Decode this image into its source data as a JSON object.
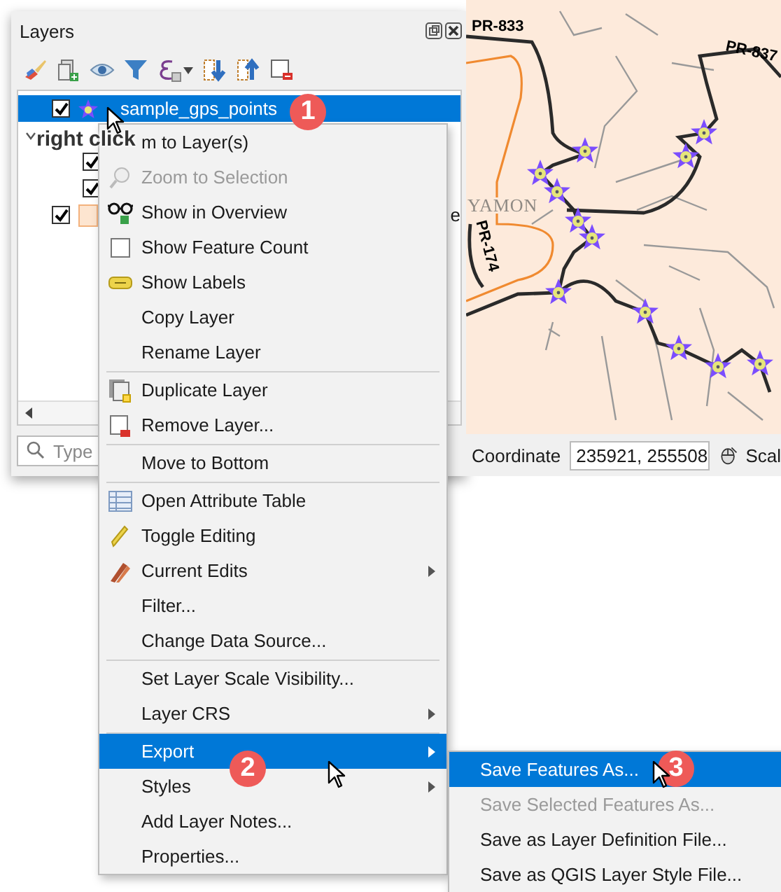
{
  "layers_panel": {
    "title": "Layers",
    "layers": [
      {
        "kind": "layer",
        "name": "sample_gps_points",
        "checked": true,
        "selected": true
      },
      {
        "kind": "group",
        "expanded": true,
        "selected": false,
        "children": [
          {
            "kind": "layer",
            "checked": true,
            "selected": false
          },
          {
            "kind": "layer",
            "checked": true,
            "selected": false
          }
        ]
      },
      {
        "kind": "layer",
        "name": "e",
        "checked": true,
        "selected": false
      }
    ],
    "search": {
      "placeholder": "Type"
    }
  },
  "map": {
    "labels": [
      {
        "kind": "road",
        "text": "PR-833"
      },
      {
        "kind": "road",
        "text": "PR-837"
      },
      {
        "kind": "road-vertical",
        "text": "PR-174"
      },
      {
        "kind": "place",
        "text": "YAMON"
      }
    ]
  },
  "status_bar": {
    "coordinate_label": "Coordinate",
    "coordinate_value": "235921, 255508",
    "scale_label": "Scal"
  },
  "annotation": "right click",
  "steps": [
    {
      "number": "1"
    },
    {
      "number": "2"
    },
    {
      "number": "3"
    }
  ],
  "context_menu": {
    "items": [
      {
        "kind": "action",
        "label": "m to Layer(s)",
        "disabled": false,
        "selected": false
      },
      {
        "kind": "action",
        "label": "Zoom to Selection",
        "disabled": true,
        "selected": false
      },
      {
        "kind": "action",
        "label": "Show in Overview",
        "disabled": false,
        "selected": false
      },
      {
        "kind": "checkbox",
        "label": "Show Feature Count",
        "checked": false,
        "disabled": false,
        "selected": false
      },
      {
        "kind": "action",
        "label": "Show Labels",
        "disabled": false,
        "selected": false
      },
      {
        "kind": "action",
        "label": "Copy Layer",
        "disabled": false,
        "selected": false
      },
      {
        "kind": "action",
        "label": "Rename Layer",
        "disabled": false,
        "selected": false
      },
      {
        "kind": "separator"
      },
      {
        "kind": "action",
        "label": "Duplicate Layer",
        "disabled": false,
        "selected": false
      },
      {
        "kind": "action",
        "label": "Remove Layer...",
        "disabled": false,
        "selected": false
      },
      {
        "kind": "separator"
      },
      {
        "kind": "action",
        "label": "Move to Bottom",
        "disabled": false,
        "selected": false
      },
      {
        "kind": "separator"
      },
      {
        "kind": "action",
        "label": "Open Attribute Table",
        "disabled": false,
        "selected": false
      },
      {
        "kind": "action",
        "label": "Toggle Editing",
        "disabled": false,
        "selected": false
      },
      {
        "kind": "submenu",
        "label": "Current Edits",
        "disabled": false,
        "selected": false
      },
      {
        "kind": "action",
        "label": "Filter...",
        "disabled": false,
        "selected": false
      },
      {
        "kind": "action",
        "label": "Change Data Source...",
        "disabled": false,
        "selected": false
      },
      {
        "kind": "separator"
      },
      {
        "kind": "action",
        "label": "Set Layer Scale Visibility...",
        "disabled": false,
        "selected": false
      },
      {
        "kind": "submenu",
        "label": "Layer CRS",
        "disabled": false,
        "selected": false
      },
      {
        "kind": "separator"
      },
      {
        "kind": "submenu",
        "label": "Export",
        "disabled": false,
        "selected": true
      },
      {
        "kind": "submenu",
        "label": "Styles",
        "disabled": false,
        "selected": false
      },
      {
        "kind": "action",
        "label": "Add Layer Notes...",
        "disabled": false,
        "selected": false
      },
      {
        "kind": "action",
        "label": "Properties...",
        "disabled": false,
        "selected": false
      }
    ]
  },
  "export_submenu": {
    "items": [
      {
        "kind": "action",
        "label": "Save Features As...",
        "disabled": false,
        "selected": true
      },
      {
        "kind": "action",
        "label": "Save Selected Features As...",
        "disabled": true,
        "selected": false
      },
      {
        "kind": "action",
        "label": "Save as Layer Definition File...",
        "disabled": false,
        "selected": false
      },
      {
        "kind": "action",
        "label": "Save as QGIS Layer Style File...",
        "disabled": false,
        "selected": false
      }
    ]
  }
}
